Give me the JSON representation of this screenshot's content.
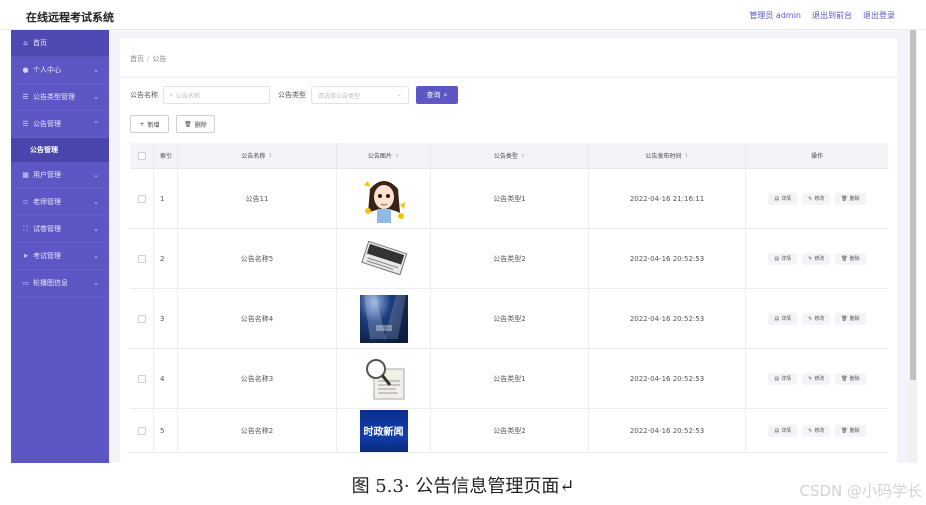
{
  "header": {
    "app_title": "在线远程考试系统",
    "links": [
      "管理员 admin",
      "退出到前台",
      "退出登录"
    ]
  },
  "sidebar": {
    "items": [
      {
        "label": "首页",
        "icon": "home-icon",
        "chevron": ""
      },
      {
        "label": "个人中心",
        "icon": "user-icon",
        "chevron": "⌄"
      },
      {
        "label": "公告类型管理",
        "icon": "list-icon",
        "chevron": "⌄"
      },
      {
        "label": "公告管理",
        "icon": "list-icon",
        "chevron": "⌃"
      },
      {
        "label": "公告管理",
        "icon": "",
        "chevron": "",
        "sub": true
      },
      {
        "label": "用户管理",
        "icon": "grid-icon",
        "chevron": "⌄"
      },
      {
        "label": "老师管理",
        "icon": "file-icon",
        "chevron": "⌄"
      },
      {
        "label": "试卷管理",
        "icon": "frame-icon",
        "chevron": "⌄"
      },
      {
        "label": "考试管理",
        "icon": "send-icon",
        "chevron": "⌄"
      },
      {
        "label": "轮播图信息",
        "icon": "image-icon",
        "chevron": "⌄"
      }
    ]
  },
  "breadcrumb": {
    "home": "首页",
    "sep": "/",
    "current": "公告"
  },
  "filters": {
    "name_label": "公告名称",
    "name_placeholder": "公告名称",
    "type_label": "公告类型",
    "type_placeholder": "请选择公告类型",
    "search_label": "查询"
  },
  "actions": {
    "add_label": "新增",
    "delete_label": "删除"
  },
  "table": {
    "headers": [
      "",
      "索引",
      "公告名称",
      "公告图片",
      "公告类型",
      "公告发布时间",
      "操作"
    ],
    "rows": [
      {
        "index": "1",
        "name": "公告11",
        "image": "cartoon-girl-image",
        "type": "公告类型1",
        "time": "2022-04-16 21:16:11"
      },
      {
        "index": "2",
        "name": "公告名称5",
        "image": "news-newspaper-image",
        "type": "公告类型2",
        "time": "2022-04-16 20:52:53"
      },
      {
        "index": "3",
        "name": "公告名称4",
        "image": "stage-spotlight-image",
        "type": "公告类型2",
        "time": "2022-04-16 20:52:53"
      },
      {
        "index": "4",
        "name": "公告名称3",
        "image": "magnifier-news-image",
        "type": "公告类型1",
        "time": "2022-04-16 20:52:53"
      },
      {
        "index": "5",
        "name": "公告名称2",
        "image": "current-news-banner-image",
        "type": "公告类型2",
        "time": "2022-04-16 20:52:53"
      }
    ],
    "ops": {
      "detail": "详情",
      "edit": "修改",
      "delete": "删除"
    },
    "banner_text": "时政新闻"
  },
  "caption": "图 5.3· 公告信息管理页面↵",
  "watermark": "CSDN @小码学长",
  "colors": {
    "primary": "#5c57c4",
    "sidebar_active": "#4a45ad"
  }
}
